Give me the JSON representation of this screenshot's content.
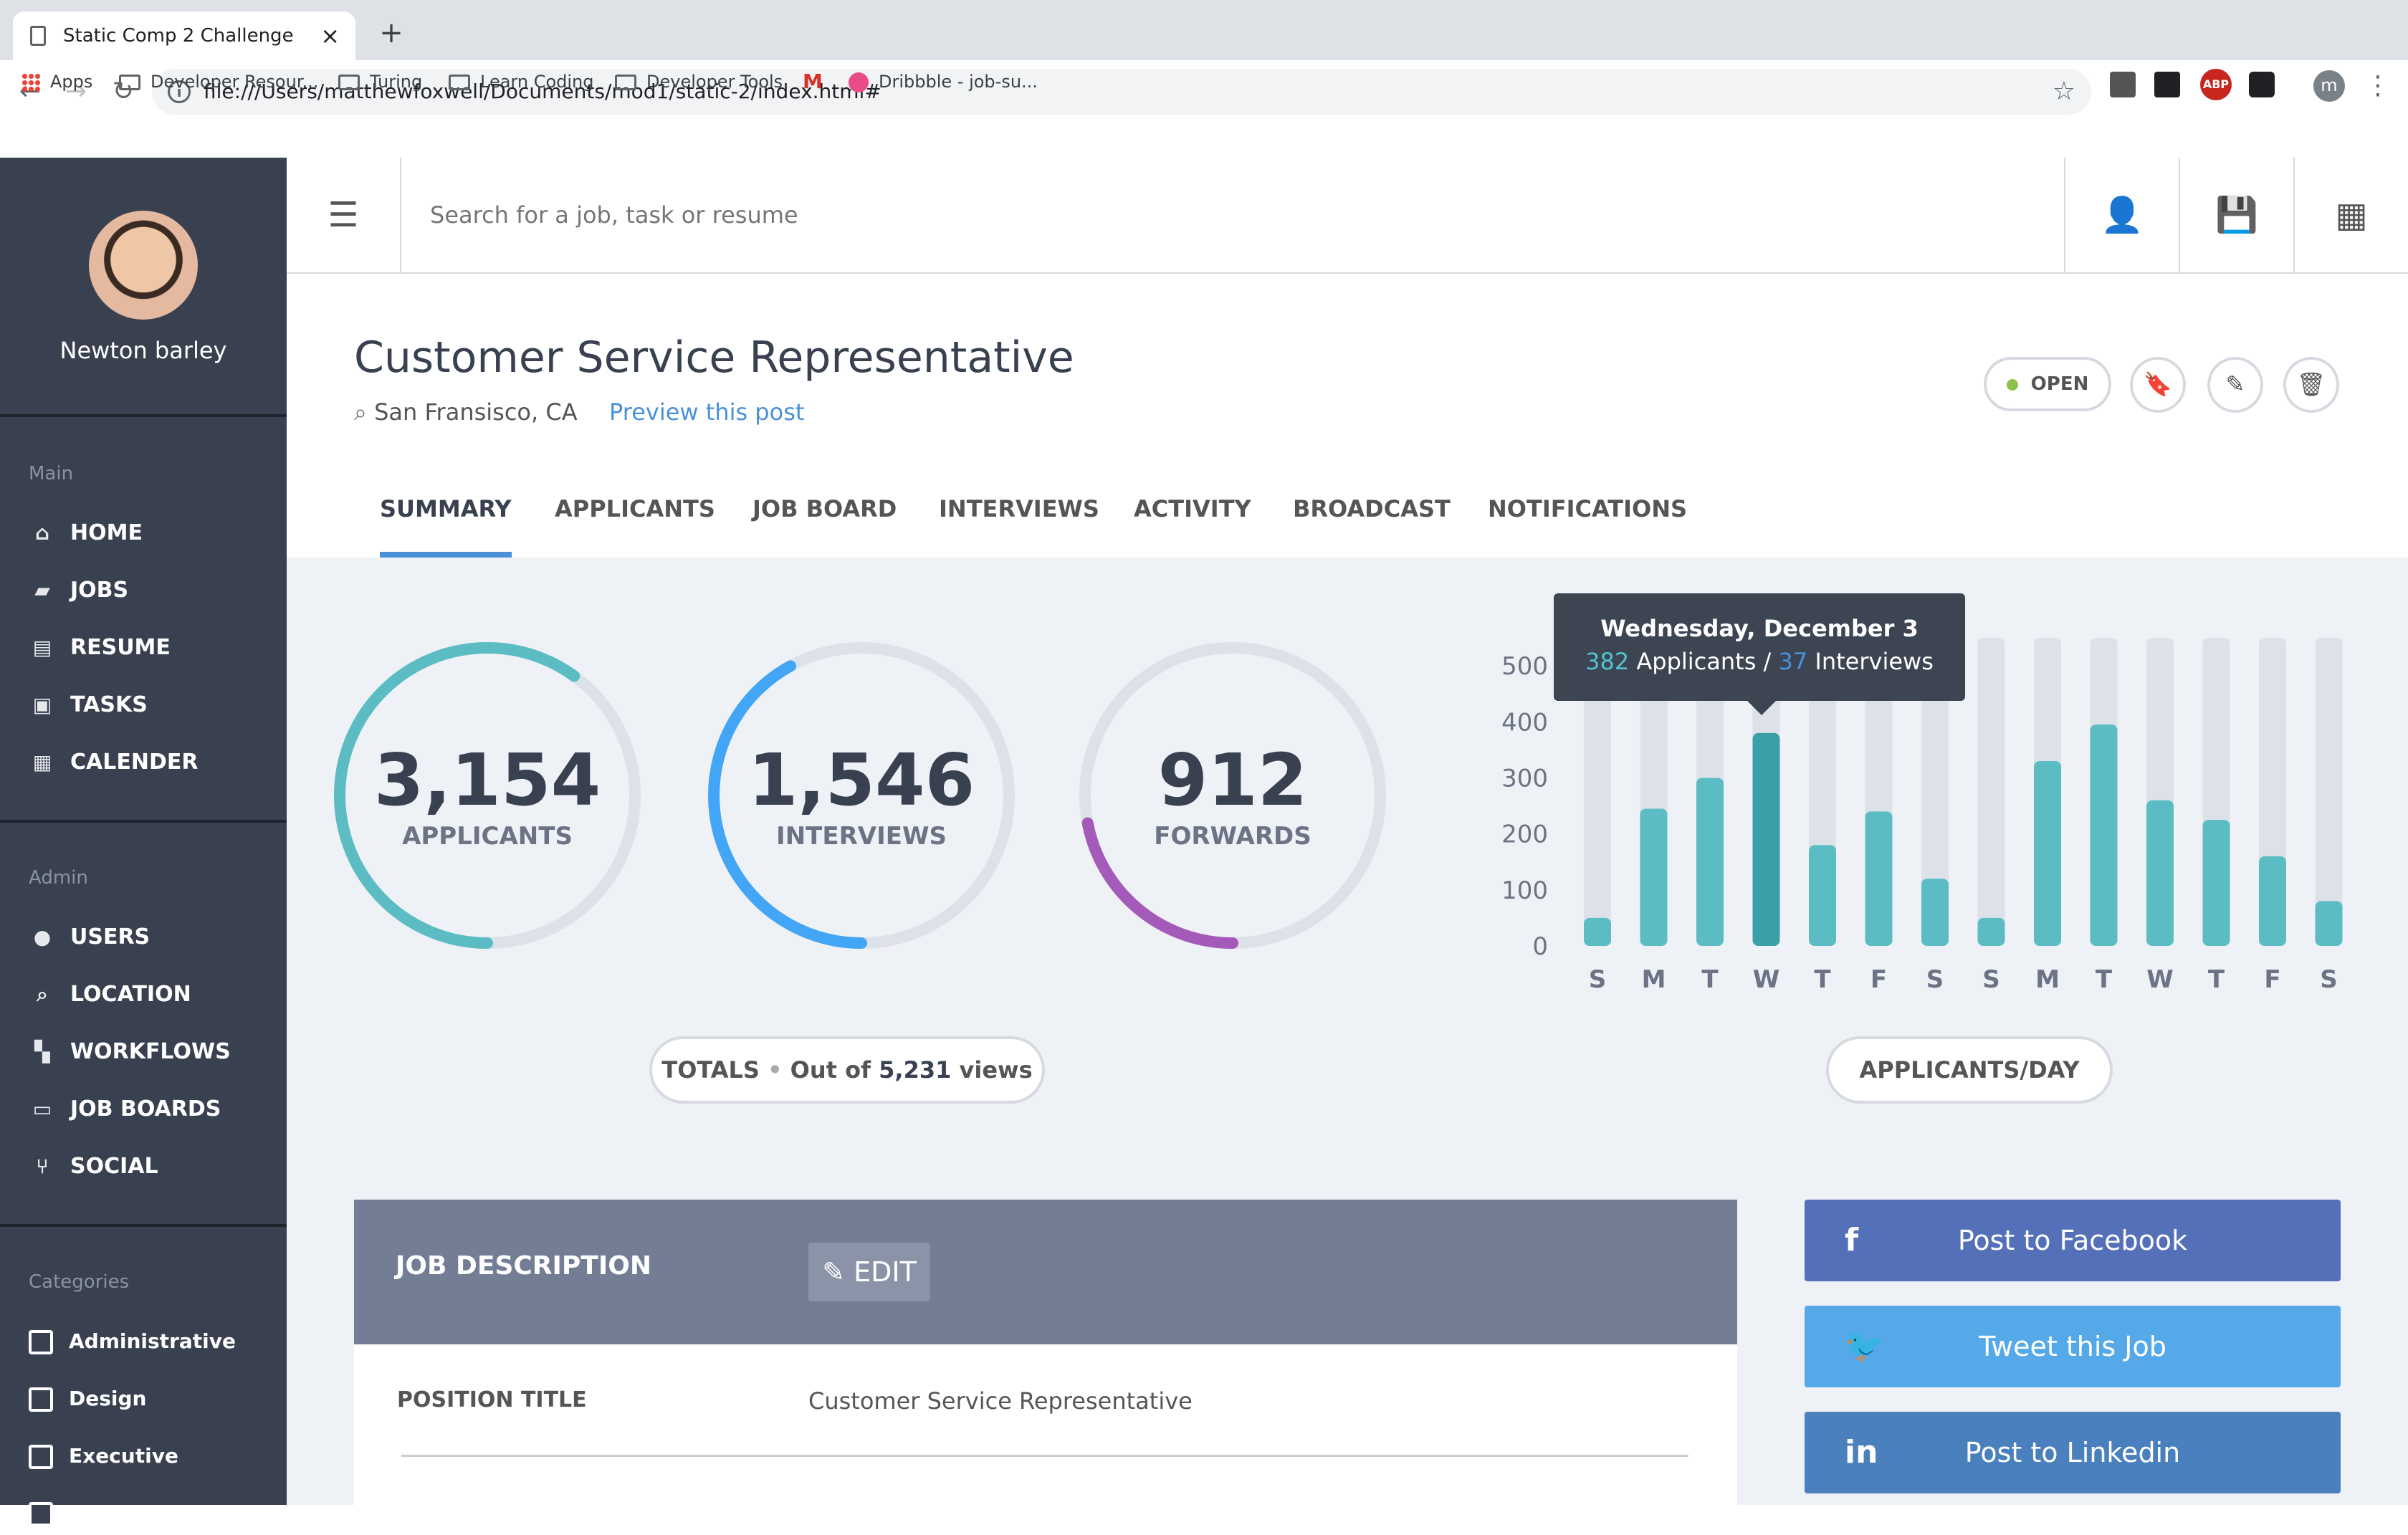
{
  "browser": {
    "tab_title": "Static Comp 2 Challenge",
    "url": "file:///Users/matthewfoxwell/Documents/mod1/static-2/index.html#",
    "bookmarks": [
      {
        "label": "Apps",
        "icon": "apps-icon"
      },
      {
        "label": "Developer Resour...",
        "icon": "folder-icon"
      },
      {
        "label": "Turing",
        "icon": "folder-icon"
      },
      {
        "label": "Learn Coding",
        "icon": "folder-icon"
      },
      {
        "label": "Developer Tools",
        "icon": "folder-icon"
      },
      {
        "label": "",
        "icon": "gmail-icon"
      },
      {
        "label": "Dribbble - job-su...",
        "icon": "dribbble-icon"
      }
    ],
    "extensions": [
      "ABP"
    ],
    "profile_initial": "m"
  },
  "sidebar": {
    "username": "Newton barley",
    "main_heading": "Main",
    "main_items": [
      {
        "label": "HOME",
        "icon": "home-icon"
      },
      {
        "label": "JOBS",
        "icon": "briefcase-icon"
      },
      {
        "label": "RESUME",
        "icon": "resume-icon"
      },
      {
        "label": "TASKS",
        "icon": "clipboard-icon"
      },
      {
        "label": "CALENDER",
        "icon": "calendar-icon"
      }
    ],
    "admin_heading": "Admin",
    "admin_items": [
      {
        "label": "USERS",
        "icon": "users-icon"
      },
      {
        "label": "LOCATION",
        "icon": "location-search-icon"
      },
      {
        "label": "WORKFLOWS",
        "icon": "workflow-icon"
      },
      {
        "label": "JOB BOARDS",
        "icon": "laptop-icon"
      },
      {
        "label": "SOCIAL",
        "icon": "branch-icon"
      }
    ],
    "categories_heading": "Categories",
    "categories": [
      "Administrative",
      "Design",
      "Executive"
    ]
  },
  "topbar": {
    "search_placeholder": "Search for a job, task or resume"
  },
  "job": {
    "title": "Customer Service Representative",
    "location": "San Fransisco, CA",
    "preview_link": "Preview this post",
    "status": "OPEN",
    "status_color": "#8bc34a"
  },
  "tabs": [
    "SUMMARY",
    "APPLICANTS",
    "JOB BOARD",
    "INTERVIEWS",
    "ACTIVITY",
    "BROADCAST",
    "NOTIFICATIONS"
  ],
  "stats": [
    {
      "value": "3,154",
      "label": "APPLICANTS",
      "fraction": 0.6,
      "color": "#5bbcc4"
    },
    {
      "value": "1,546",
      "label": "INTERVIEWS",
      "fraction": 0.42,
      "color": "#42a5f5"
    },
    {
      "value": "912",
      "label": "FORWARDS",
      "fraction": 0.22,
      "color": "#a45ab8"
    }
  ],
  "totals": {
    "label": "TOTALS",
    "text": "Out of",
    "views": "5,231",
    "suffix": "views"
  },
  "tooltip": {
    "date": "Wednesday, December 3",
    "applicants": "382",
    "applicants_label": "Applicants /",
    "interviews": "37",
    "interviews_label": "Interviews"
  },
  "chart_data": {
    "type": "bar",
    "categories": [
      "S",
      "M",
      "T",
      "W",
      "T",
      "F",
      "S",
      "S",
      "M",
      "T",
      "W",
      "T",
      "F",
      "S"
    ],
    "values": [
      50,
      245,
      300,
      380,
      180,
      240,
      120,
      50,
      330,
      395,
      260,
      225,
      160,
      80
    ],
    "highlight_index": 3,
    "ylim": [
      0,
      550
    ],
    "yticks": [
      0,
      100,
      200,
      300,
      400,
      500
    ],
    "bar_color": "#5bbcc4",
    "highlight_color": "#3a9fa8",
    "track_color": "#dde2e9",
    "label": "APPLICANTS/DAY"
  },
  "job_description": {
    "heading": "JOB DESCRIPTION",
    "edit_label": "EDIT",
    "position_title_label": "POSITION TITLE",
    "position_title_value": "Customer Service Representative"
  },
  "social": [
    {
      "label": "Post to Facebook",
      "icon": "facebook-icon",
      "glyph": "f",
      "color": "#5470b8"
    },
    {
      "label": "Tweet this Job",
      "icon": "twitter-icon",
      "glyph": "t",
      "color": "#55a9e8"
    },
    {
      "label": "Post to Linkedin",
      "icon": "linkedin-icon",
      "glyph": "in",
      "color": "#4a80be"
    }
  ]
}
